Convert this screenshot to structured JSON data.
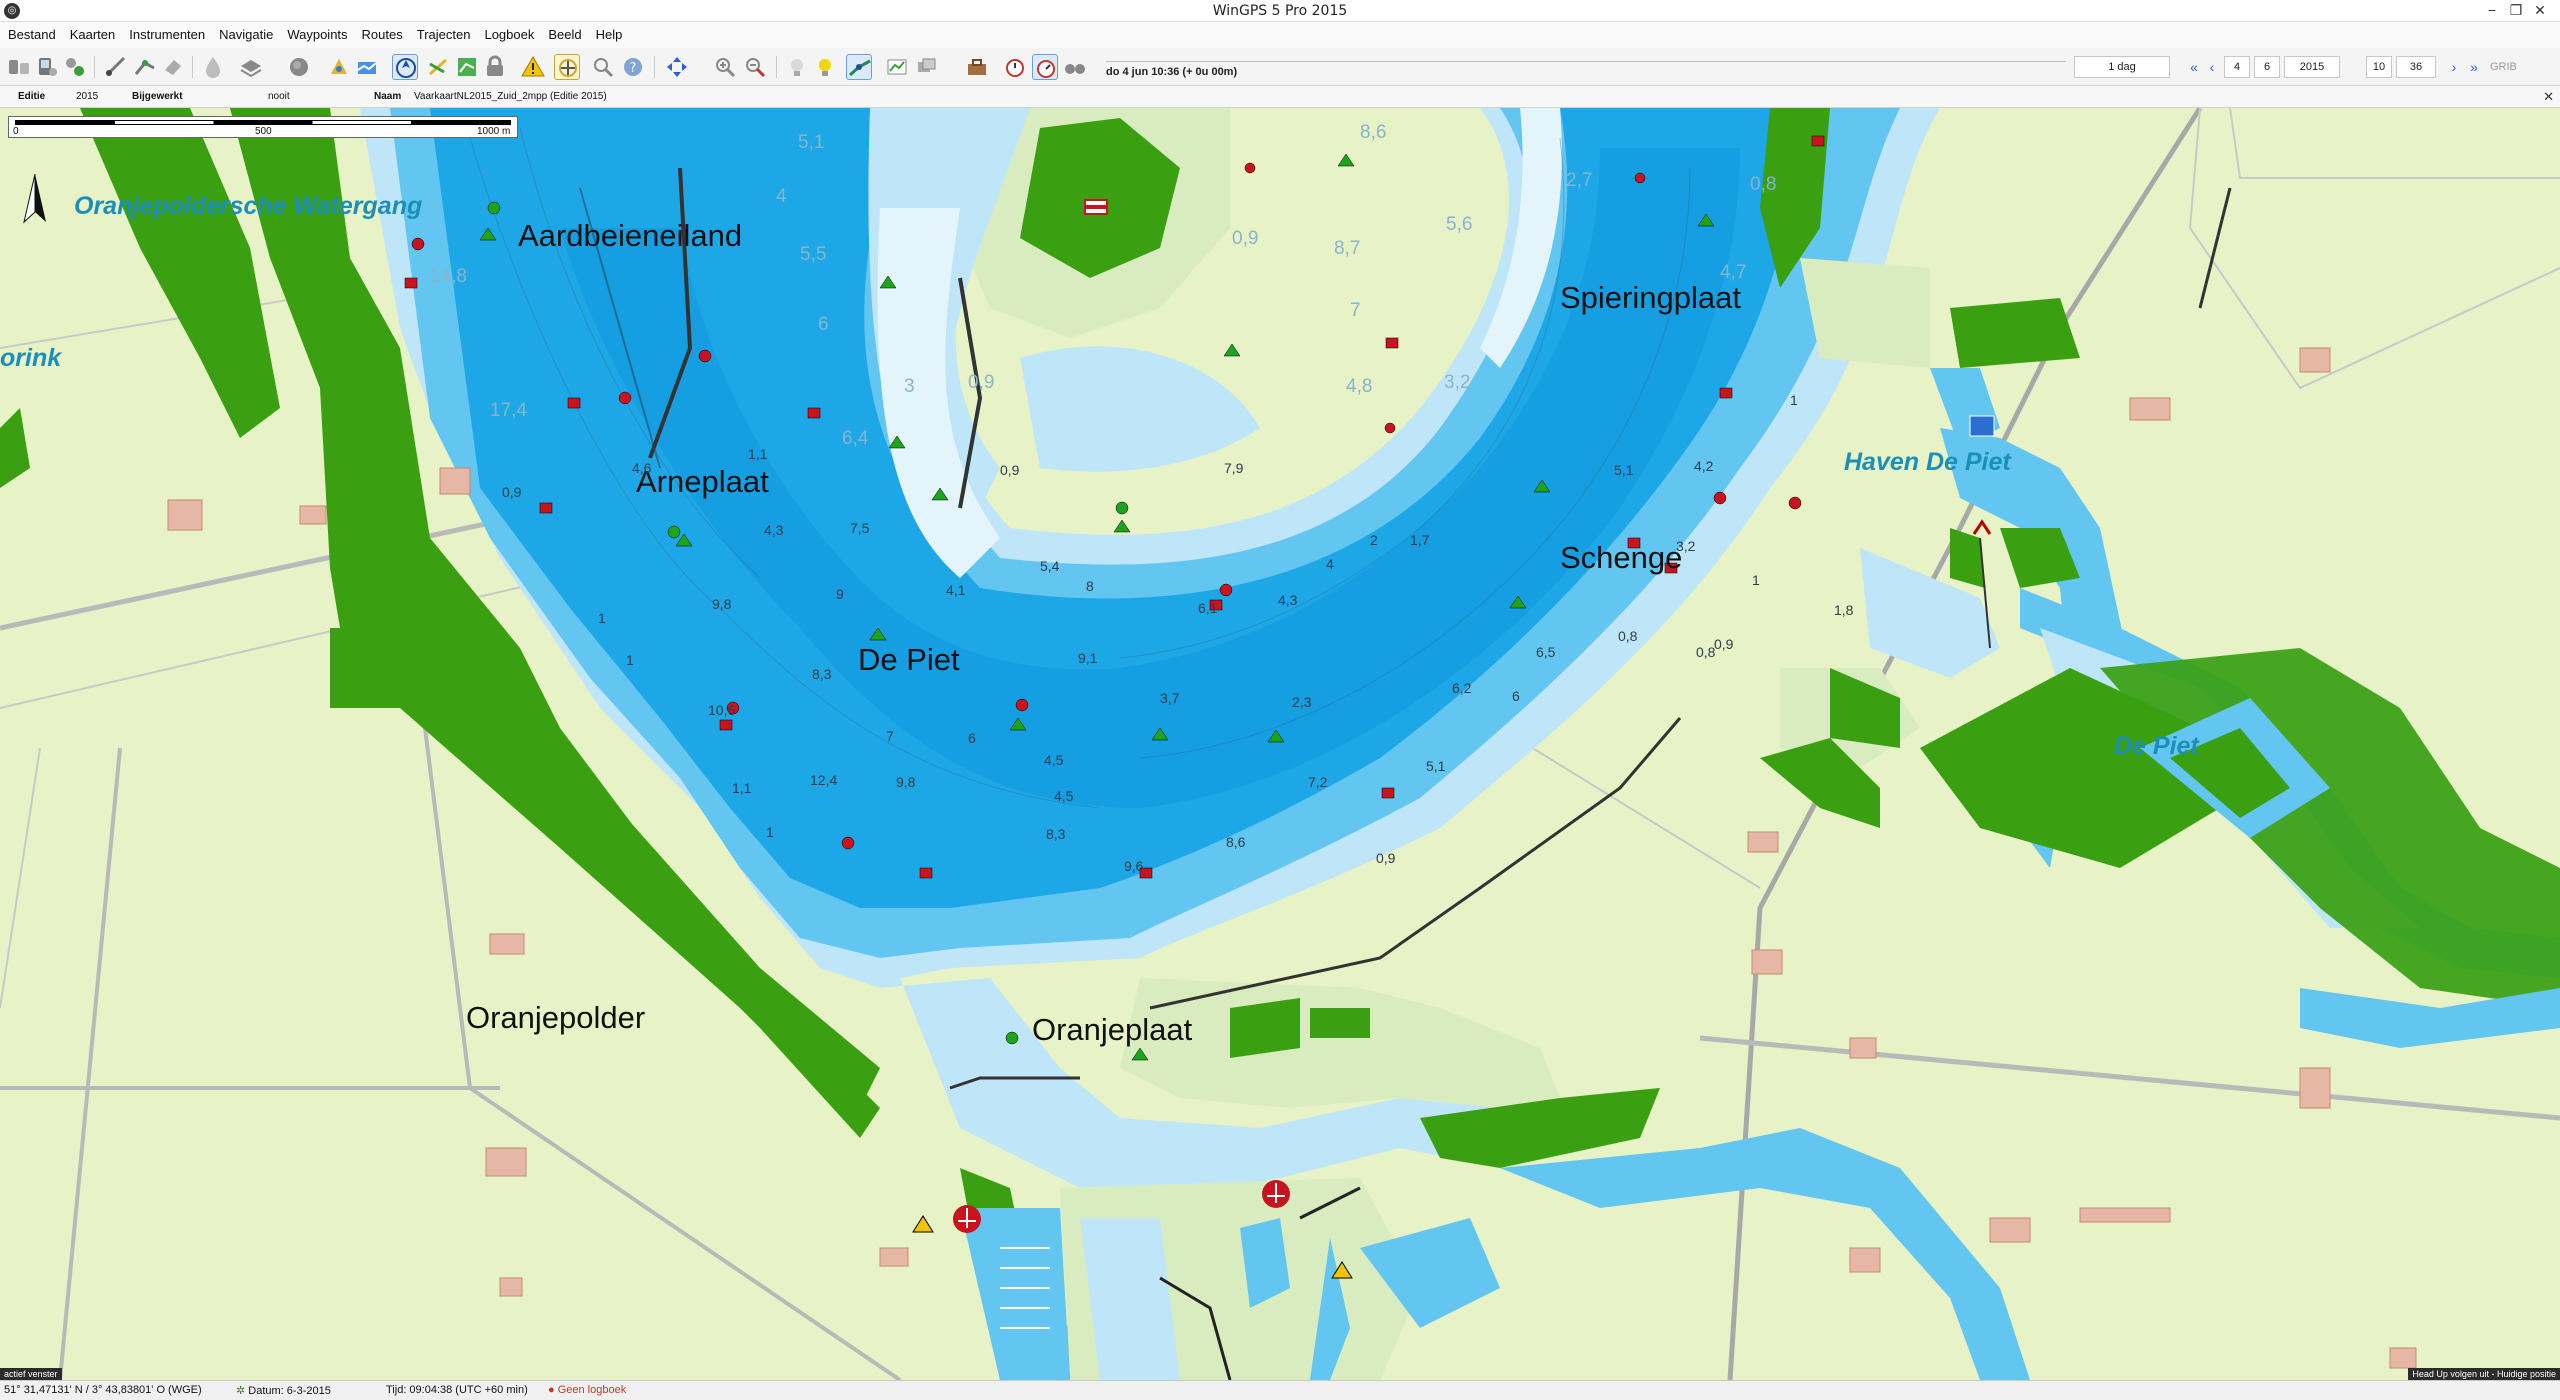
{
  "window": {
    "title": "WinGPS 5 Pro 2015",
    "minimize": "−",
    "maximize": "❐",
    "close": "✕"
  },
  "menu": [
    "Bestand",
    "Kaarten",
    "Instrumenten",
    "Navigatie",
    "Waypoints",
    "Routes",
    "Trajecten",
    "Logboek",
    "Beeld",
    "Help"
  ],
  "toolbar": {
    "datetime": "do 4 jun 10:36 (+ 0u 00m)",
    "period": "1 dag",
    "day": "4",
    "month": "6",
    "year": "2015",
    "hour": "10",
    "minute": "36",
    "grib_label": "GRIB"
  },
  "chartbar": {
    "edition_label": "Editie",
    "edition_value": "2015",
    "updated_label": "Bijgewerkt",
    "updated_value": "nooit",
    "name_label": "Naam",
    "name_value": "VaarkaartNL2015_Zuid_2mpp (Editie 2015)",
    "close": "✕"
  },
  "map": {
    "scale": {
      "start": "0",
      "mid": "500",
      "end": "1000 m"
    },
    "labels": {
      "aardbeieneiland": "Aardbeieneiland",
      "spieringplaat": "Spieringplaat",
      "arneplaat": "Arneplaat",
      "schenge": "Schenge",
      "de_piet": "De Piet",
      "oranjepolder": "Oranjepolder",
      "oranjeplaat": "Oranjeplaat",
      "watergang": "Oranjepoldersche Watergang",
      "rink": "orink",
      "haven": "Haven De Piet",
      "de_piet_water": "De Piet"
    },
    "depths": {
      "d1": "5,1",
      "d2": "4",
      "d3": "5,5",
      "d4": "6",
      "d5": "3",
      "d6": "0,9",
      "d7": "8,6",
      "d8": "5,6",
      "d9": "0,9",
      "d10": "8,7",
      "d11": "2,7",
      "d12": "0,8",
      "d13": "14,8",
      "d14": "17,4",
      "d15": "1,1",
      "d16": "6,4",
      "d17": "0,9",
      "d18": "4,3",
      "d19": "7,5",
      "d20": "9",
      "d21": "9,8",
      "d22": "8,3",
      "d23": "7,9",
      "d24": "4,5",
      "d25": "5,4",
      "d26": "8",
      "d27": "4,1",
      "d28": "6,1",
      "d29": "4,3",
      "d30": "9,1",
      "d31": "3,7",
      "d32": "2,3",
      "d33": "1,7",
      "d34": "2",
      "d35": "7",
      "d36": "4,8",
      "d37": "3,2",
      "d38": "4,7",
      "d39": "4,2",
      "d40": "5,1",
      "d41": "3,2",
      "d42": "1,8",
      "d43": "6,5",
      "d44": "6,2",
      "d45": "6",
      "d46": "7,2",
      "d47": "5,1",
      "d48": "0,8",
      "d49": "0,9",
      "d50": "12,4",
      "d51": "9,8",
      "d52": "8,3",
      "d53": "8,6",
      "d54": "9,6",
      "d55": "0,9",
      "d56": "10,6",
      "d57": "7",
      "d58": "6",
      "d59": "4,5",
      "d60": "1,1",
      "d61": "1",
      "d62": "1",
      "d63": "1",
      "d64": "4,6",
      "d65": "0,9",
      "d66": "4",
      "d67": "0,8",
      "d68": "1",
      "d69": "1"
    },
    "overlay_left": "actief venster",
    "overlay_right": "Head Up volgen uit - Huidige positie"
  },
  "status": {
    "position": "51° 31,47131' N / 3° 43,83801' O (WGE)",
    "date_label": "Datum: 6-3-2015",
    "time_label": "Tijd: 09:04:38 (UTC +60 min)",
    "logbook": "Geen logboek"
  },
  "colors": {
    "land": "#e7f2c6",
    "green": "#3aa012",
    "deep_water": "#1ea7e6",
    "mid_water": "#62c6f1",
    "shallow_water": "#bfe6f8",
    "tidal_flat": "#d9ecc0",
    "buoy_red": "#c8141e",
    "buoy_green": "#1ca51c"
  }
}
